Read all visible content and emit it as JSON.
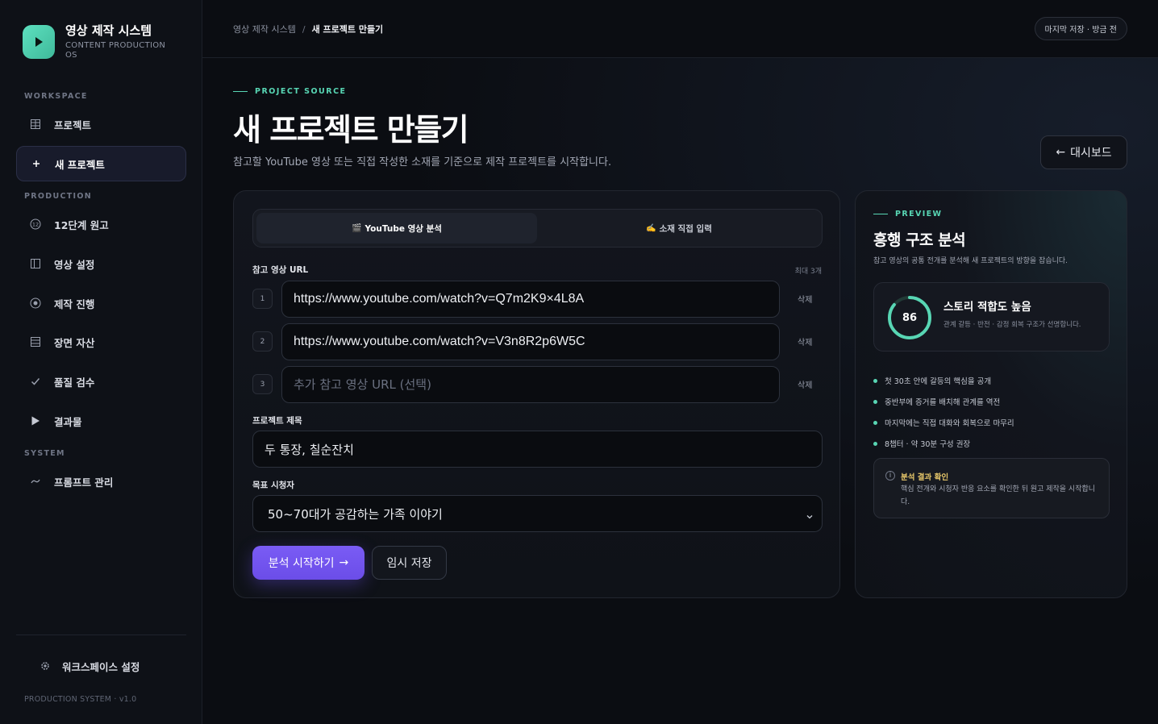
{
  "brand": {
    "title": "영상 제작 시스템",
    "subtitle": "CONTENT PRODUCTION OS",
    "logo_icon": "play-icon",
    "accent_color": "#58d6b4"
  },
  "sidebar": {
    "sections": {
      "workspace": "WORKSPACE",
      "production": "PRODUCTION",
      "system": "SYSTEM"
    },
    "items": [
      {
        "label": "프로젝트",
        "icon": "grid-icon"
      },
      {
        "label": "새 프로젝트",
        "icon": "plus-icon",
        "active": true
      },
      {
        "label": "12단계 원고",
        "icon": "number-12-icon"
      },
      {
        "label": "영상 설정",
        "icon": "columns-icon"
      },
      {
        "label": "제작 진행",
        "icon": "target-icon"
      },
      {
        "label": "장면 자산",
        "icon": "list-icon"
      },
      {
        "label": "품질 검수",
        "icon": "check-icon"
      },
      {
        "label": "결과물",
        "icon": "play-icon"
      },
      {
        "label": "프롬프트 관리",
        "icon": "prompt-icon"
      }
    ],
    "settings_label": "워크스페이스 설정",
    "version": "PRODUCTION SYSTEM · v1.0"
  },
  "topbar": {
    "breadcrumb_root": "영상 제작 시스템",
    "breadcrumb_sep": "/",
    "breadcrumb_current": "새 프로젝트 만들기",
    "save_status": "마지막 저장 · 방금 전"
  },
  "header": {
    "eyebrow": "PROJECT SOURCE",
    "title": "새 프로젝트 만들기",
    "description": "참고할 YouTube 영상 또는 직접 작성한 소재를 기준으로 제작 프로젝트를 시작합니다.",
    "back_label": "대시보드",
    "back_arrow": "←"
  },
  "form": {
    "tabs": [
      {
        "emoji": "🎬",
        "label": "YouTube 영상 분석",
        "active": true
      },
      {
        "emoji": "✍️",
        "label": "소재 직접 입력",
        "active": false
      }
    ],
    "url_label": "참고 영상 URL",
    "url_max": "최대 3개",
    "urls": [
      {
        "num": "1",
        "value": "https://www.youtube.com/watch?v=Q7m2K9×4L8A",
        "placeholder": ""
      },
      {
        "num": "2",
        "value": "https://www.youtube.com/watch?v=V3n8R2p6W5C",
        "placeholder": ""
      },
      {
        "num": "3",
        "value": "",
        "placeholder": "추가 참고 영상 URL (선택)"
      }
    ],
    "delete_label": "삭제",
    "title_label": "프로젝트 제목",
    "title_value": "두 통장, 칠순잔치",
    "audience_label": "목표 시청자",
    "audience_value": "50~70대가 공감하는 가족 이야기",
    "primary_label": "분석 시작하기",
    "primary_arrow": "→",
    "secondary_label": "임시 저장",
    "primary_color": "#6b4de8"
  },
  "preview": {
    "eyebrow": "PREVIEW",
    "title": "흥행 구조 분석",
    "description": "참고 영상의 공통 전개를 분석해 새 프로젝트의 방향을 잡습니다.",
    "score": 86,
    "score_title": "스토리 적합도 높음",
    "score_desc": "관계 갈등 · 반전 · 감정 회복 구조가 선명합니다.",
    "bullets": [
      "첫 30초 안에 갈등의 핵심을 공개",
      "중반부에 증거를 배치해 관계를 역전",
      "마지막에는 직접 대화와 회복으로 마무리",
      "8챕터 · 약 30분 구성 권장"
    ],
    "notice_title": "분석 결과 확인",
    "notice_text": "핵심 전개와 시청자 반응 요소를 확인한 뒤 원고 제작을 시작합니다.",
    "notice_color": "#e8c86a"
  }
}
